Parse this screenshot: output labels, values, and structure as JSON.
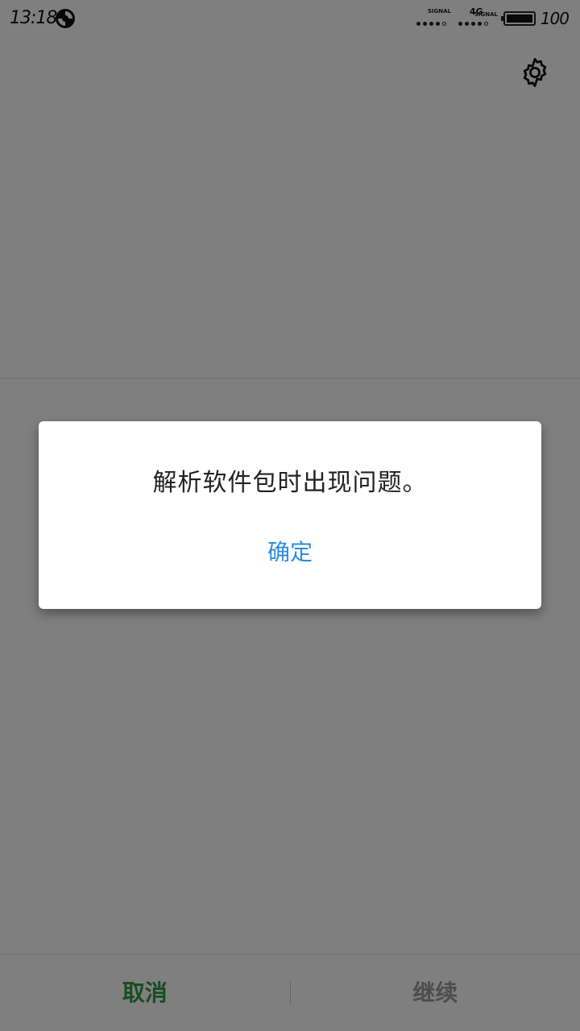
{
  "status_bar": {
    "time": "13:18",
    "signal_label_1": "SIGNAL",
    "network_type": "4G",
    "signal_label_2": "SIGNAL",
    "battery_level": "100"
  },
  "bottom_bar": {
    "cancel_label": "取消",
    "continue_label": "继续"
  },
  "dialog": {
    "message": "解析软件包时出现问题。",
    "ok_label": "确定"
  },
  "colors": {
    "cancel": "#2e9a45",
    "continue_disabled": "#9a9a9a",
    "dialog_button": "#2a8de0",
    "overlay": "rgba(0,0,0,0.5)"
  },
  "icons": {
    "sync": "sync-icon",
    "settings": "gear-icon",
    "battery": "battery-icon"
  }
}
